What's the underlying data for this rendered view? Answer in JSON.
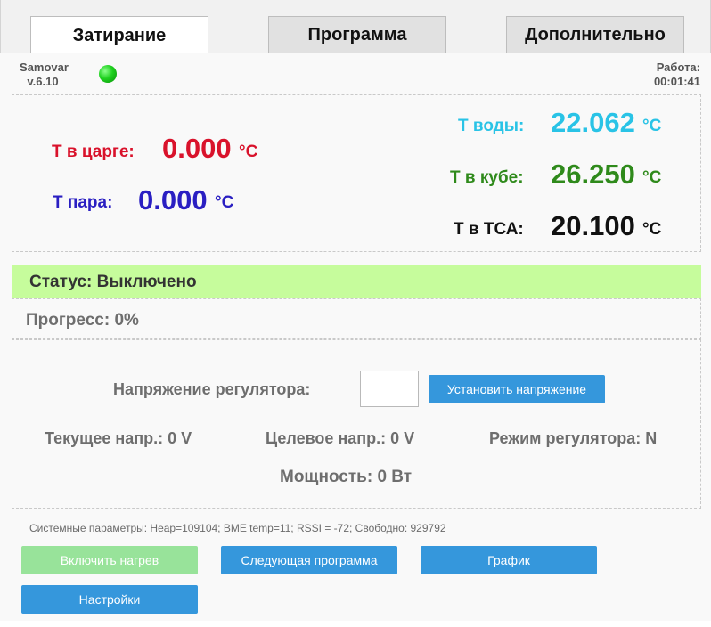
{
  "tabs": [
    {
      "label": "Затирание",
      "active": true
    },
    {
      "label": "Программа",
      "active": false
    },
    {
      "label": "Дополнительно",
      "active": false
    }
  ],
  "brand": {
    "name": "Samovar",
    "version": "v.6.10",
    "led_color": "#1fd11f"
  },
  "runtime": {
    "label": "Работа:",
    "value": "00:01:41"
  },
  "temps": {
    "tsarga": {
      "label": "Т в царге:",
      "value": "0.000",
      "unit": "°C",
      "color": "#d9122b"
    },
    "steam": {
      "label": "Т пара:",
      "value": "0.000",
      "unit": "°C",
      "color": "#2a1fc2"
    },
    "water": {
      "label": "Т воды:",
      "value": "22.062",
      "unit": "°C",
      "color": "#29c3e6"
    },
    "cube": {
      "label": "Т в кубе:",
      "value": "26.250",
      "unit": "°C",
      "color": "#2f8a1b"
    },
    "tsa": {
      "label": "Т в ТСА:",
      "value": "20.100",
      "unit": "°C",
      "color": "#111111"
    }
  },
  "status": {
    "text": "Статус: Выключено",
    "color": "#c6fc9c"
  },
  "progress": {
    "text": "Прогресс: 0%",
    "value": 0
  },
  "regulator": {
    "voltage_label": "Напряжение регулятора:",
    "voltage_input": "",
    "set_button": "Установить напряжение",
    "current": "Текущее напр.: 0 V",
    "target": "Целевое напр.: 0 V",
    "mode": "Режим регулятора: N",
    "power": "Мощность: 0 Вт"
  },
  "system": {
    "text": "Системные параметры: Heap=109104; BME temp=11; RSSI = -72; Свободно: 929792"
  },
  "buttons": {
    "heat_on": "Включить нагрев",
    "next_program": "Следующая программа",
    "chart": "График",
    "settings": "Настройки"
  }
}
